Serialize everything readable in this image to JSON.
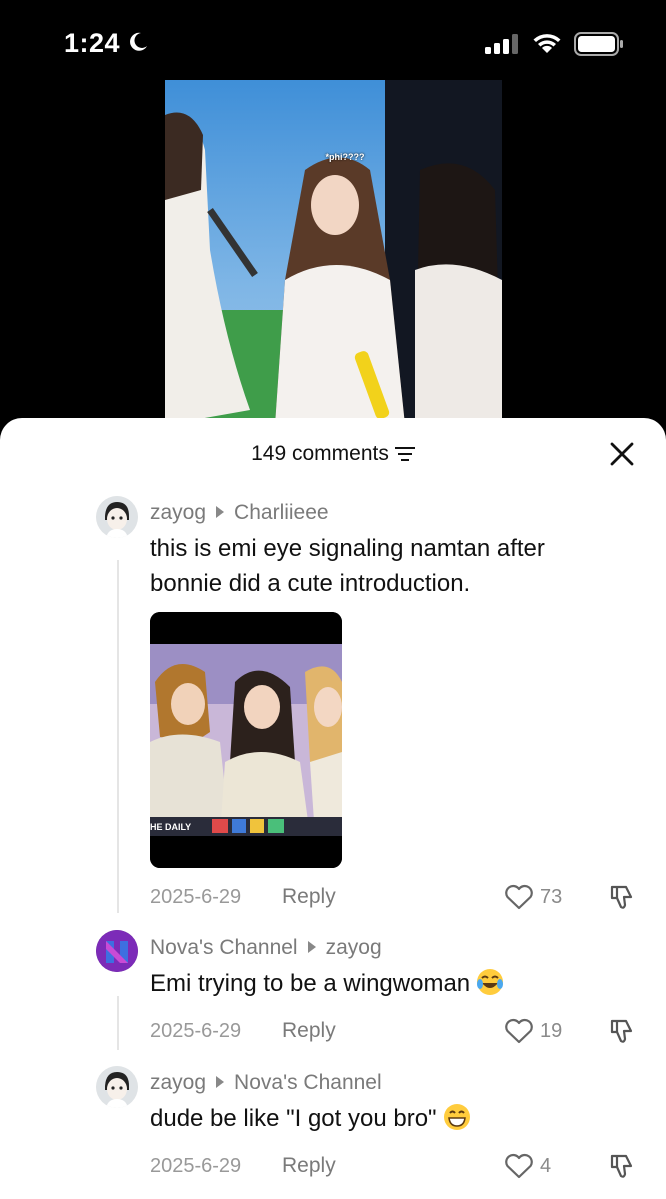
{
  "status_bar": {
    "time": "1:24"
  },
  "video": {
    "caption": "*phi????"
  },
  "sheet": {
    "comment_count": "149 comments",
    "comments": [
      {
        "user": "zayog",
        "reply_to": "Charliieee",
        "text": "this is emi eye signaling namtan after bonnie did a cute introduction.",
        "image_watermark": "HE DAILY",
        "date": "2025-6-29",
        "reply_label": "Reply",
        "likes": "73"
      },
      {
        "user": "Nova's Channel",
        "reply_to": "zayog",
        "text": "Emi trying to be a wingwoman",
        "emoji": "laughing-tears-emoji",
        "date": "2025-6-29",
        "reply_label": "Reply",
        "likes": "19"
      },
      {
        "user": "zayog",
        "reply_to": "Nova's Channel",
        "text": "dude be like \"I got you bro\"",
        "emoji": "grinning-emoji",
        "date": "2025-6-29",
        "reply_label": "Reply",
        "likes": "4"
      }
    ]
  },
  "colors": {
    "background": "#000000",
    "sheet": "#ffffff",
    "muted": "#7a7a7a",
    "text": "#111111"
  }
}
